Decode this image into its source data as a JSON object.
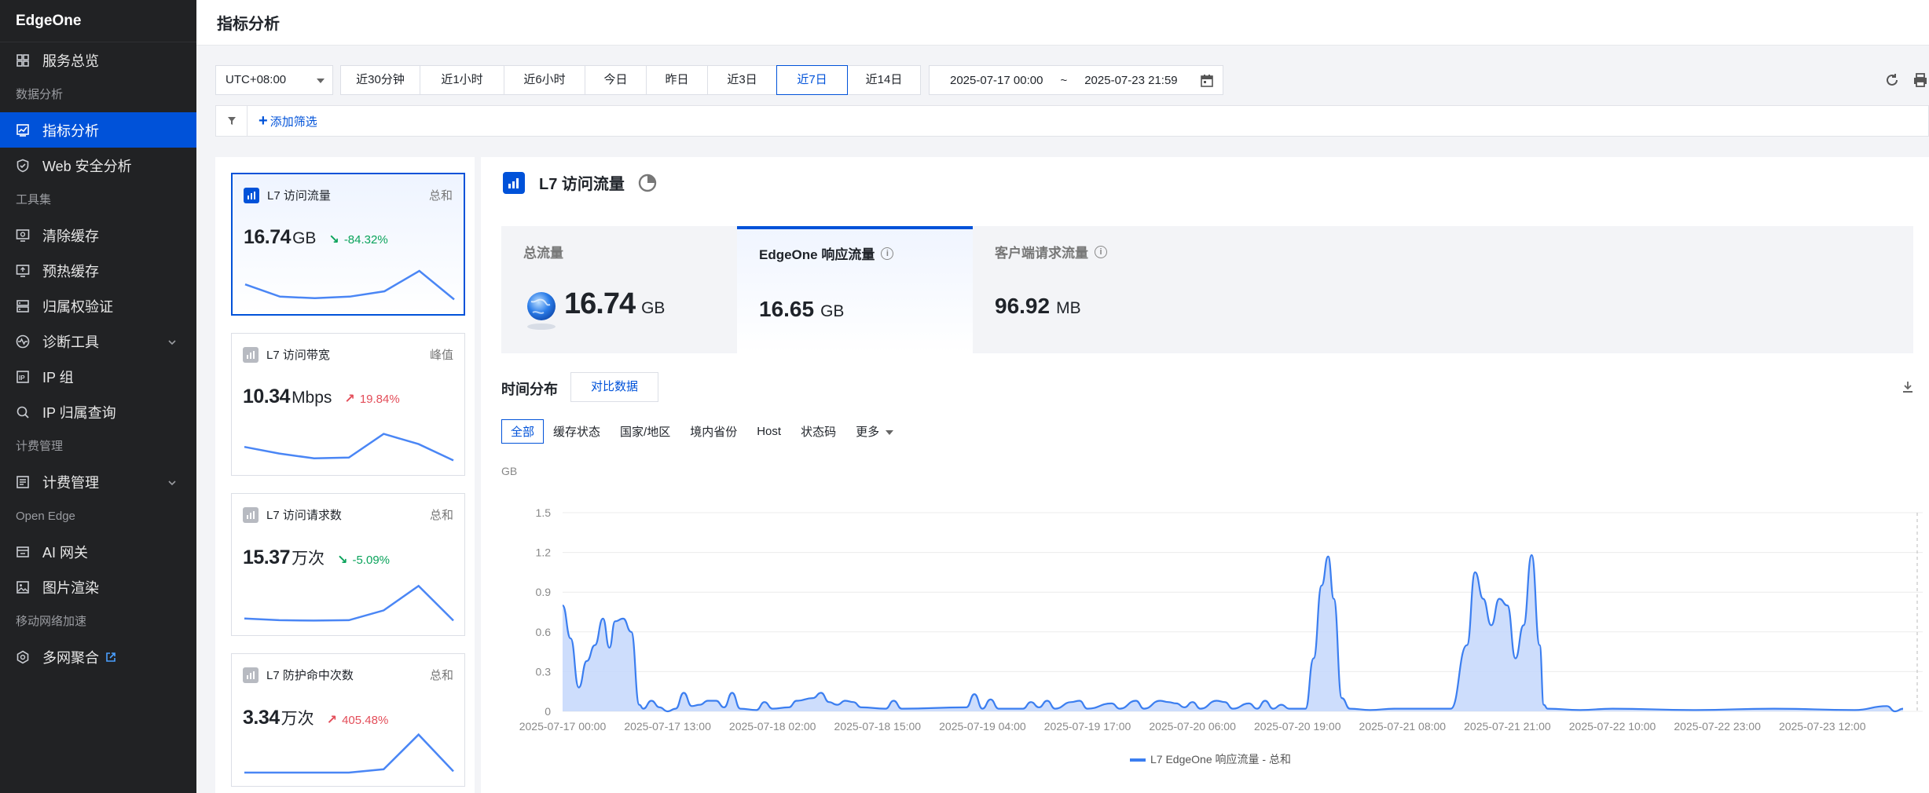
{
  "app": {
    "title": "EdgeOne"
  },
  "sidebar": {
    "items": [
      {
        "type": "item",
        "label": "服务总览",
        "icon": "grid-icon",
        "name": "sidebar-item-overview"
      },
      {
        "type": "group",
        "label": "数据分析"
      },
      {
        "type": "item",
        "label": "指标分析",
        "icon": "chart-icon",
        "name": "sidebar-item-metrics",
        "active": true
      },
      {
        "type": "item",
        "label": "Web 安全分析",
        "icon": "shield-icon",
        "name": "sidebar-item-web-security"
      },
      {
        "type": "group",
        "label": "工具集"
      },
      {
        "type": "item",
        "label": "清除缓存",
        "icon": "monitor-clear-icon",
        "name": "sidebar-item-purge-cache"
      },
      {
        "type": "item",
        "label": "预热缓存",
        "icon": "monitor-up-icon",
        "name": "sidebar-item-prefetch-cache"
      },
      {
        "type": "item",
        "label": "归属权验证",
        "icon": "server-icon",
        "name": "sidebar-item-ownership"
      },
      {
        "type": "item",
        "label": "诊断工具",
        "icon": "pulse-icon",
        "name": "sidebar-item-diagnostics",
        "chevron": true
      },
      {
        "type": "item",
        "label": "IP 组",
        "icon": "ip-icon",
        "name": "sidebar-item-ip-group"
      },
      {
        "type": "item",
        "label": "IP 归属查询",
        "icon": "search-icon",
        "name": "sidebar-item-ip-lookup"
      },
      {
        "type": "group",
        "label": "计费管理"
      },
      {
        "type": "item",
        "label": "计费管理",
        "icon": "billing-icon",
        "name": "sidebar-item-billing",
        "chevron": true
      },
      {
        "type": "group",
        "label": "Open Edge"
      },
      {
        "type": "item",
        "label": "AI 网关",
        "icon": "gateway-icon",
        "name": "sidebar-item-ai-gateway"
      },
      {
        "type": "item",
        "label": "图片渲染",
        "icon": "image-icon",
        "name": "sidebar-item-image-render"
      },
      {
        "type": "group",
        "label": "移动网络加速"
      },
      {
        "type": "item",
        "label": "多网聚合",
        "icon": "network-icon",
        "name": "sidebar-item-multi-network",
        "external": true
      }
    ]
  },
  "header": {
    "title": "指标分析"
  },
  "filters": {
    "timezone": "UTC+08:00",
    "ranges": [
      {
        "label": "近30分钟",
        "w": 102
      },
      {
        "label": "近1小时",
        "w": 108
      },
      {
        "label": "近6小时",
        "w": 104
      },
      {
        "label": "今日",
        "w": 79
      },
      {
        "label": "昨日",
        "w": 79
      },
      {
        "label": "近3日",
        "w": 89
      },
      {
        "label": "近7日",
        "w": 91,
        "active": true
      },
      {
        "label": "近14日",
        "w": 94
      }
    ],
    "start": "2025-07-17 00:00",
    "tilde": "~",
    "end": "2025-07-23 21:59",
    "add_filter": "添加筛选"
  },
  "metric_cards": [
    {
      "title": "L7 访问流量",
      "agg": "总和",
      "value": "16.74",
      "unit": "GB",
      "delta": "-84.32%",
      "dir": "down",
      "active": true,
      "spark": [
        0.42,
        0.12,
        0.08,
        0.12,
        0.25,
        0.75,
        0.05
      ]
    },
    {
      "title": "L7 访问带宽",
      "agg": "峰值",
      "value": "10.34",
      "unit": "Mbps",
      "delta": "19.84%",
      "dir": "up",
      "spark": [
        0.38,
        0.22,
        0.1,
        0.12,
        0.7,
        0.45,
        0.05
      ]
    },
    {
      "title": "L7 访问请求数",
      "agg": "总和",
      "value": "15.37",
      "unit": "万次",
      "delta": "-5.09%",
      "dir": "down",
      "spark": [
        0.1,
        0.06,
        0.05,
        0.06,
        0.3,
        0.9,
        0.05
      ]
    },
    {
      "title": "L7 防护命中次数",
      "agg": "总和",
      "value": "3.34",
      "unit": "万次",
      "delta": "405.48%",
      "dir": "up",
      "spark": [
        0.02,
        0.02,
        0.02,
        0.02,
        0.1,
        0.95,
        0.05
      ]
    }
  ],
  "main": {
    "title": "L7 访问流量",
    "stats": [
      {
        "label": "总流量",
        "value": "16.74",
        "unit": "GB"
      },
      {
        "label": "EdgeOne 响应流量",
        "value": "16.65",
        "unit": "GB",
        "info": true,
        "active": true
      },
      {
        "label": "客户端请求流量",
        "value": "96.92",
        "unit": "MB",
        "info": true
      }
    ],
    "dist_title": "时间分布",
    "compare": "对比数据",
    "tabs": [
      "全部",
      "缓存状态",
      "国家/地区",
      "境内省份",
      "Host",
      "状态码",
      "更多"
    ]
  },
  "chart_data": {
    "type": "area",
    "ylabel": "GB",
    "ylim": [
      0,
      1.5
    ],
    "yticks": [
      0,
      0.3,
      0.6,
      0.9,
      1.2,
      1.5
    ],
    "xticks": [
      "2025-07-17 00:00",
      "2025-07-17 13:00",
      "2025-07-18 02:00",
      "2025-07-18 15:00",
      "2025-07-19 04:00",
      "2025-07-19 17:00",
      "2025-07-20 06:00",
      "2025-07-20 19:00",
      "2025-07-21 08:00",
      "2025-07-21 21:00",
      "2025-07-22 10:00",
      "2025-07-22 23:00",
      "2025-07-23 12:00"
    ],
    "xlim_hours": [
      0,
      166
    ],
    "series": [
      {
        "name": "L7 EdgeOne 响应流量 - 总和",
        "color": "#3b7ef0",
        "points": [
          [
            0,
            0.8
          ],
          [
            1,
            0.55
          ],
          [
            2,
            0.18
          ],
          [
            3,
            0.38
          ],
          [
            4,
            0.5
          ],
          [
            5,
            0.7
          ],
          [
            5.8,
            0.48
          ],
          [
            6.5,
            0.68
          ],
          [
            7.5,
            0.7
          ],
          [
            8.5,
            0.6
          ],
          [
            9.5,
            0.05
          ],
          [
            10,
            0.02
          ],
          [
            11,
            0.08
          ],
          [
            12,
            0.03
          ],
          [
            13,
            0.0
          ],
          [
            14,
            0.02
          ],
          [
            15,
            0.14
          ],
          [
            16,
            0.04
          ],
          [
            17,
            0.05
          ],
          [
            18,
            0.08
          ],
          [
            19,
            0.08
          ],
          [
            20,
            0.03
          ],
          [
            21,
            0.14
          ],
          [
            22,
            0.02
          ],
          [
            24,
            0.01
          ],
          [
            25,
            0.07
          ],
          [
            26,
            0.02
          ],
          [
            28,
            0.03
          ],
          [
            29,
            0.08
          ],
          [
            31,
            0.1
          ],
          [
            32,
            0.14
          ],
          [
            33,
            0.07
          ],
          [
            34,
            0.05
          ],
          [
            35,
            0.08
          ],
          [
            36,
            0.07
          ],
          [
            37,
            0.03
          ],
          [
            40,
            0.02
          ],
          [
            41,
            0.08
          ],
          [
            42,
            0.02
          ],
          [
            50,
            0.03
          ],
          [
            51,
            0.13
          ],
          [
            52,
            0.02
          ],
          [
            53,
            0.09
          ],
          [
            54,
            0.02
          ],
          [
            57,
            0.02
          ],
          [
            58,
            0.07
          ],
          [
            59,
            0.03
          ],
          [
            60,
            0.08
          ],
          [
            61,
            0.02
          ],
          [
            63,
            0.07
          ],
          [
            64,
            0.08
          ],
          [
            65,
            0.02
          ],
          [
            68,
            0.06
          ],
          [
            69,
            0.02
          ],
          [
            71,
            0.08
          ],
          [
            72,
            0.02
          ],
          [
            74,
            0.08
          ],
          [
            75,
            0.07
          ],
          [
            76,
            0.06
          ],
          [
            77,
            0.03
          ],
          [
            78,
            0.07
          ],
          [
            79,
            0.02
          ],
          [
            81,
            0.08
          ],
          [
            82,
            0.07
          ],
          [
            83,
            0.02
          ],
          [
            85,
            0.06
          ],
          [
            86,
            0.02
          ],
          [
            87,
            0.08
          ],
          [
            88,
            0.02
          ],
          [
            89,
            0.05
          ],
          [
            90,
            0.02
          ],
          [
            92,
            0.02
          ],
          [
            93,
            0.4
          ],
          [
            94,
            0.95
          ],
          [
            94.8,
            1.17
          ],
          [
            95.5,
            0.85
          ],
          [
            96.5,
            0.1
          ],
          [
            97.5,
            0.02
          ],
          [
            100,
            0.01
          ],
          [
            103,
            0.02
          ],
          [
            110,
            0.02
          ],
          [
            112,
            0.5
          ],
          [
            113,
            1.05
          ],
          [
            114,
            0.85
          ],
          [
            115,
            0.65
          ],
          [
            116,
            0.85
          ],
          [
            117,
            0.8
          ],
          [
            118,
            0.4
          ],
          [
            119,
            0.65
          ],
          [
            120,
            1.18
          ],
          [
            121,
            0.5
          ],
          [
            121.5,
            0.05
          ],
          [
            122,
            0.02
          ],
          [
            126,
            0.01
          ],
          [
            130,
            0.02
          ],
          [
            140,
            0.01
          ],
          [
            150,
            0.02
          ],
          [
            160,
            0.01
          ],
          [
            164,
            0.04
          ],
          [
            165,
            0.0
          ],
          [
            166,
            0.02
          ]
        ]
      }
    ]
  }
}
